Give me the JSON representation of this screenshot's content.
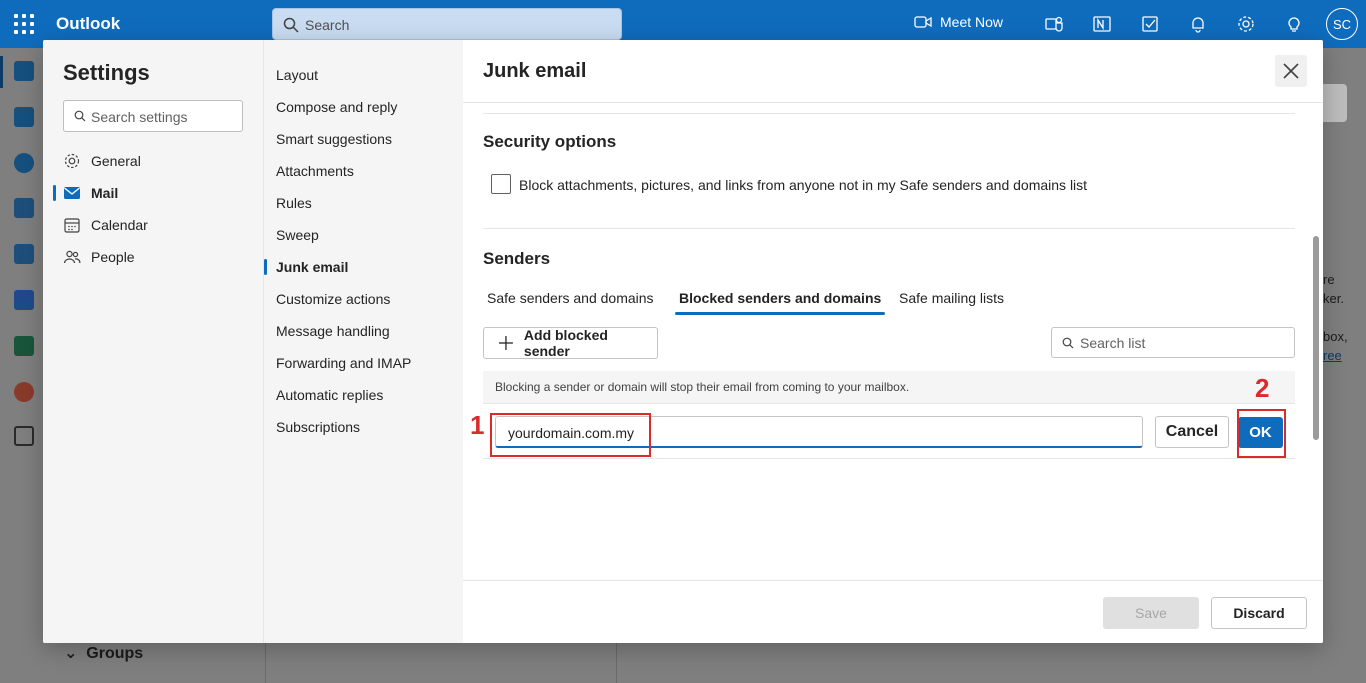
{
  "app": {
    "name": "Outlook"
  },
  "topbar": {
    "search_placeholder": "Search",
    "meet_now_label": "Meet Now",
    "avatar_initials": "SC"
  },
  "background": {
    "groups_label": "Groups",
    "right_fragments": [
      "re",
      "ker.",
      "box,",
      "ree"
    ]
  },
  "settings": {
    "title": "Settings",
    "search_placeholder": "Search settings",
    "categories": [
      {
        "label": "General",
        "icon": "gear-icon"
      },
      {
        "label": "Mail",
        "icon": "mail-icon",
        "active": true
      },
      {
        "label": "Calendar",
        "icon": "calendar-icon"
      },
      {
        "label": "People",
        "icon": "people-icon"
      }
    ],
    "mail_sections": [
      "Layout",
      "Compose and reply",
      "Smart suggestions",
      "Attachments",
      "Rules",
      "Sweep",
      "Junk email",
      "Customize actions",
      "Message handling",
      "Forwarding and IMAP",
      "Automatic replies",
      "Subscriptions"
    ],
    "active_section": "Junk email"
  },
  "pane": {
    "title": "Junk email",
    "security": {
      "heading": "Security options",
      "checkbox_label": "Block attachments, pictures, and links from anyone not in my Safe senders and domains list",
      "checked": false
    },
    "senders": {
      "heading": "Senders",
      "tabs": [
        "Safe senders and domains",
        "Blocked senders and domains",
        "Safe mailing lists"
      ],
      "active_tab": "Blocked senders and domains",
      "add_button_label": "Add blocked sender",
      "search_list_placeholder": "Search list",
      "info_text": "Blocking a sender or domain will stop their email from coming to your mailbox.",
      "entry_value": "yourdomain.com.my",
      "cancel_label": "Cancel",
      "ok_label": "OK"
    },
    "footer": {
      "save_label": "Save",
      "discard_label": "Discard"
    }
  },
  "annotations": {
    "step1": "1",
    "step2": "2",
    "color": "#d92b2b"
  },
  "colors": {
    "accent": "#0f6cbd"
  }
}
